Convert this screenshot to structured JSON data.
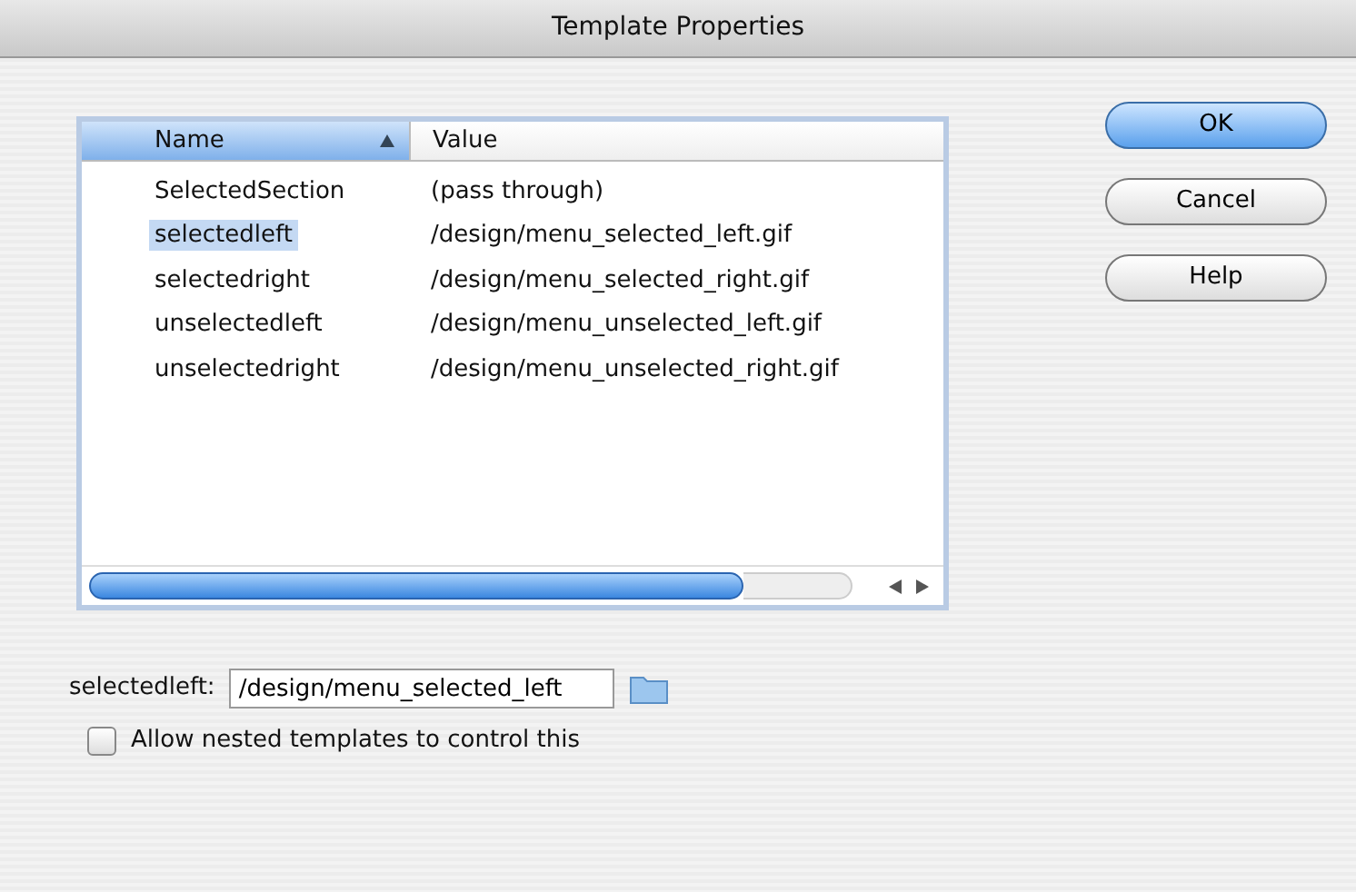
{
  "window": {
    "title": "Template Properties"
  },
  "table": {
    "columns": [
      {
        "label": "Name",
        "sorted": true
      },
      {
        "label": "Value",
        "sorted": false
      }
    ],
    "rows": [
      {
        "name": "SelectedSection",
        "value": "(pass through)",
        "selected": false
      },
      {
        "name": "selectedleft",
        "value": "/design/menu_selected_left.gif",
        "selected": true
      },
      {
        "name": "selectedright",
        "value": "/design/menu_selected_right.gif",
        "selected": false
      },
      {
        "name": "unselectedleft",
        "value": "/design/menu_unselected_left.gif",
        "selected": false
      },
      {
        "name": "unselectedright",
        "value": "/design/menu_unselected_right.gif",
        "selected": false
      }
    ]
  },
  "field": {
    "label": "selectedleft:",
    "value": "/design/menu_selected_left"
  },
  "checkbox": {
    "label": "Allow nested templates to control this",
    "checked": false
  },
  "buttons": [
    {
      "label": "OK",
      "default": true
    },
    {
      "label": "Cancel",
      "default": false
    },
    {
      "label": "Help",
      "default": false
    }
  ]
}
